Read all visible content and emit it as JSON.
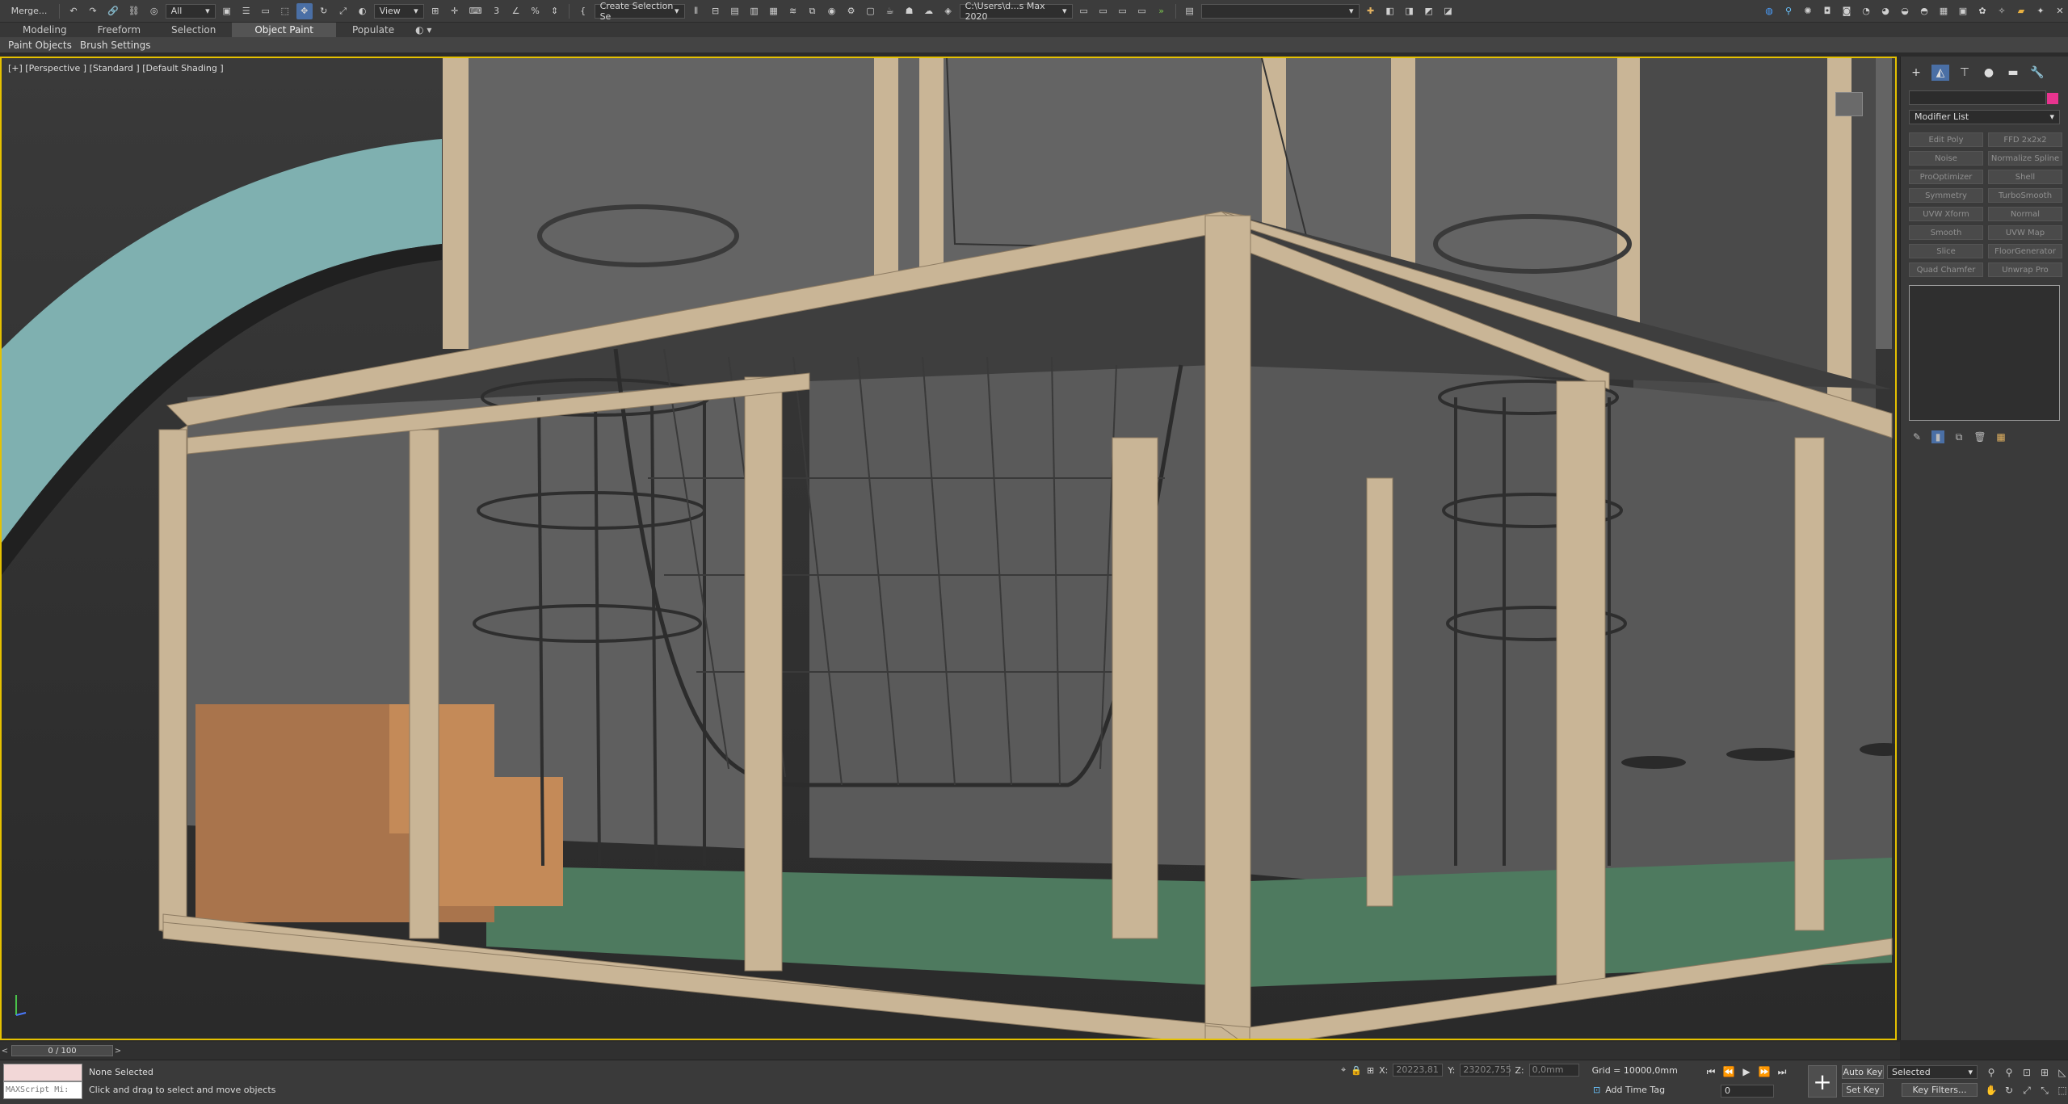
{
  "toolbar": {
    "merge_label": "Merge...",
    "selection_filter": "All",
    "ref_coord": "View",
    "selection_set": "Create Selection Se",
    "path_field": "C:\\Users\\d...s Max 2020",
    "workspace_field": "",
    "snap_label": "3",
    "angle_snap": "%"
  },
  "ribbon": {
    "tabs": [
      "Modeling",
      "Freeform",
      "Selection",
      "Object Paint",
      "Populate"
    ],
    "active_tab": "Object Paint",
    "sub_items": [
      "Paint Objects",
      "Brush Settings"
    ]
  },
  "viewport": {
    "label": "[+] [Perspective ] [Standard ] [Default Shading ]",
    "colors": {
      "border": "#e5c100",
      "frame": "#c9b596",
      "glass": "#5b5b5b",
      "floor": "#4e7a5f",
      "slide": "#7fb0b0",
      "cushion": "#a9744c",
      "net": "#3a3a3a"
    }
  },
  "command_panel": {
    "modifier_list": "Modifier List",
    "object_color": "#e8348f",
    "modifiers": [
      "Edit Poly",
      "FFD 2x2x2",
      "Noise",
      "Normalize Spline",
      "ProOptimizer",
      "Shell",
      "Symmetry",
      "TurboSmooth",
      "UVW Xform",
      "Normal",
      "Smooth",
      "UVW Map",
      "Slice",
      "FloorGenerator",
      "Quad Chamfer",
      "Unwrap Pro"
    ]
  },
  "timeline": {
    "frame_display": "0 / 100"
  },
  "status": {
    "maxscript_label": "MAXScript Mi:",
    "selection_status": "None Selected",
    "prompt": "Click and drag to select and move objects",
    "x_label": "X:",
    "x_value": "20223,81",
    "y_label": "Y:",
    "y_value": "23202,755",
    "z_label": "Z:",
    "z_value": "0,0mm",
    "grid": "Grid = 10000,0mm",
    "add_time_tag": "Add Time Tag",
    "auto_key": "Auto Key",
    "set_key": "Set Key",
    "selected_dropdown": "Selected",
    "key_filters": "Key Filters...",
    "frame_number": "0"
  }
}
